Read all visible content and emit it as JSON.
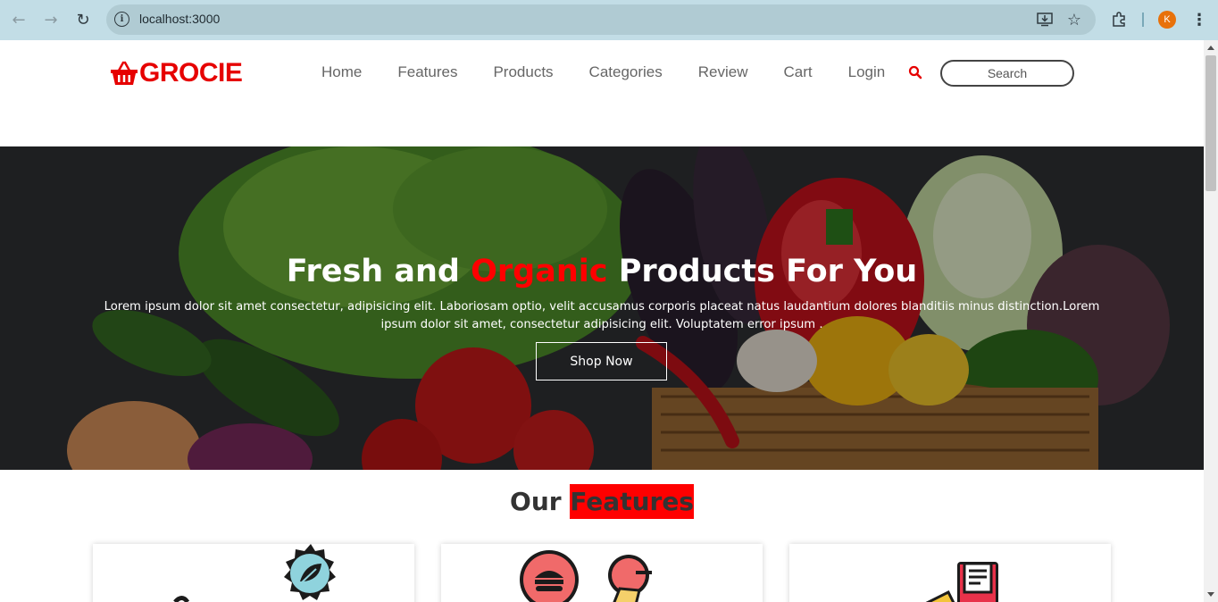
{
  "browser": {
    "url": "localhost:3000",
    "profile_initial": "K",
    "icons": [
      "back-arrow-icon",
      "forward-arrow-icon",
      "reload-icon",
      "site-info-icon",
      "install-app-icon",
      "bookmark-star-icon",
      "extensions-icon",
      "kebab-menu-icon"
    ]
  },
  "header": {
    "logo_text": "GROCIE",
    "nav": [
      "Home",
      "Features",
      "Products",
      "Categories",
      "Review",
      "Cart",
      "Login"
    ],
    "search_placeholder": "Search",
    "accent_color": "#e60000"
  },
  "hero": {
    "title_part1": "Fresh and",
    "title_accent": "Organic",
    "title_part2": "Products For You",
    "description": "Lorem ipsum dolor sit amet consectetur, adipisicing elit. Laboriosam optio, velit accusamus corporis placeat natus laudantium dolores blanditiis minus distinction.Lorem ipsum dolor sit amet, consectetur adipisicing elit. Voluptatem error ipsum .",
    "cta_label": "Shop Now"
  },
  "features": {
    "title_part1": "Our",
    "title_highlight": "Features",
    "highlight_color": "#ff0000",
    "cards": [
      {
        "icon": "organic-leaf-badge-icon"
      },
      {
        "icon": "food-delivery-icon"
      },
      {
        "icon": "payment-receipt-icon"
      }
    ]
  }
}
